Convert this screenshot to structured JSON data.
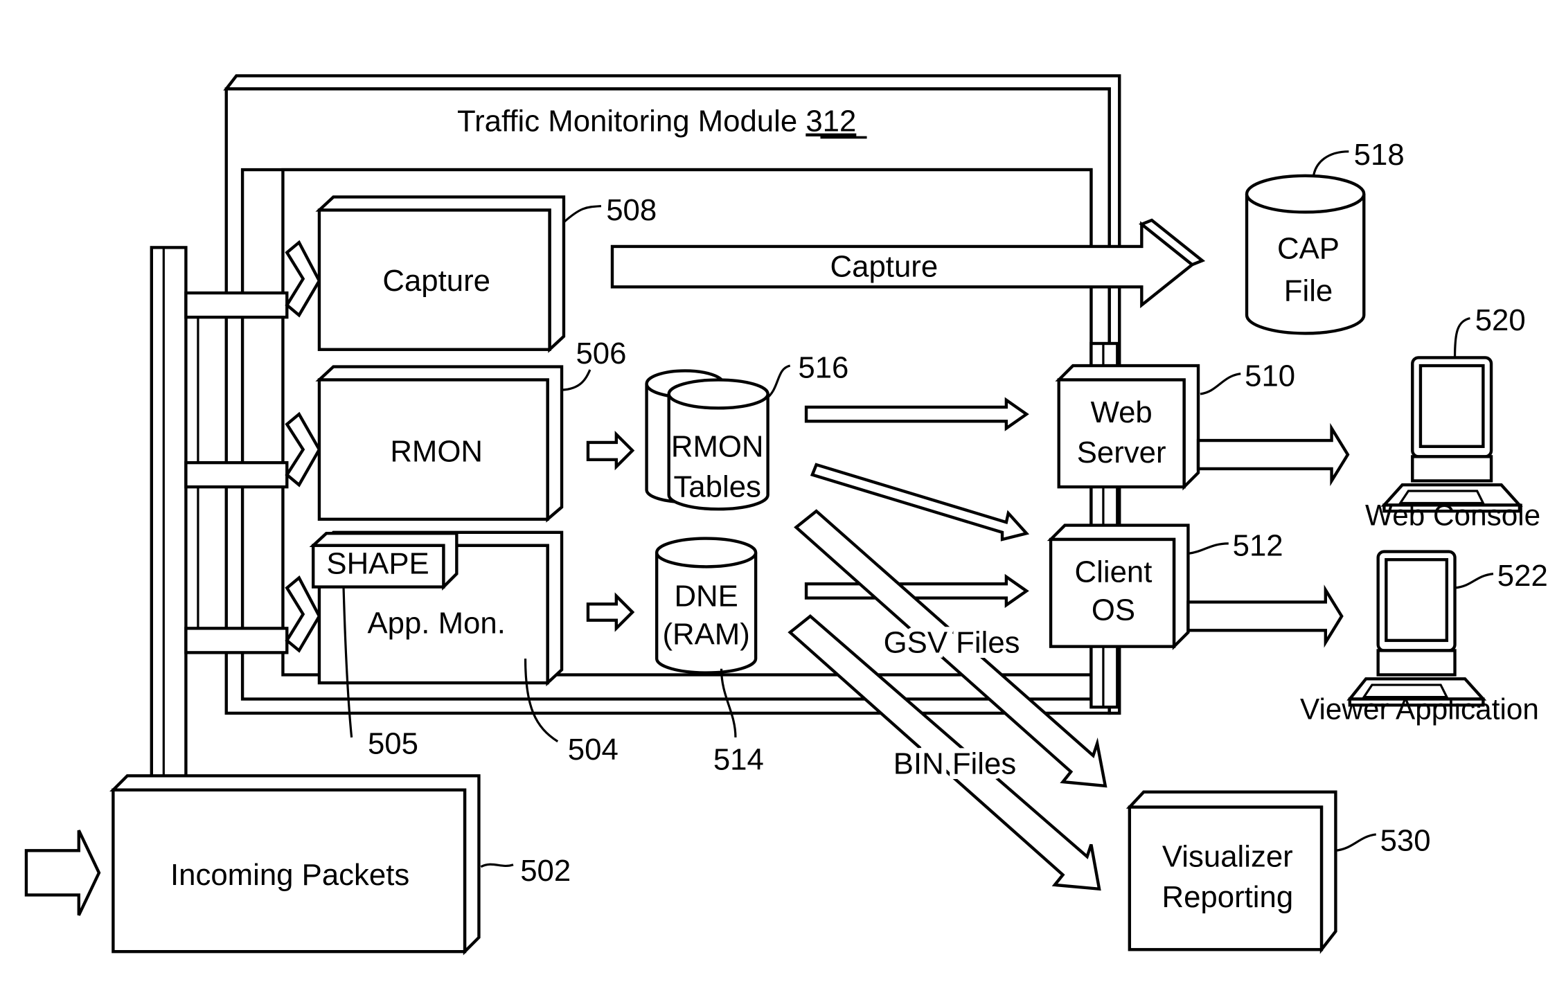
{
  "module": {
    "title_text": "Traffic Monitoring Module ",
    "title_ref": "312"
  },
  "blocks": {
    "capture": {
      "label": "Capture",
      "ref": "508"
    },
    "rmon": {
      "label": "RMON",
      "ref": "506"
    },
    "app_mon": {
      "label": "App. Mon.",
      "ref": "504"
    },
    "shape": {
      "label": "SHAPE",
      "ref": "505"
    },
    "incoming": {
      "label": "Incoming Packets",
      "ref": "502"
    },
    "web_server": {
      "line1": "Web",
      "line2": "Server",
      "ref": "510"
    },
    "client_os": {
      "line1": "Client",
      "line2": "OS",
      "ref": "512"
    },
    "visualizer": {
      "line1": "Visualizer",
      "line2": "Reporting",
      "ref": "530"
    }
  },
  "stores": {
    "rmon_tables": {
      "line1": "RMON",
      "line2": "Tables",
      "ref": "516"
    },
    "dne_ram": {
      "line1": "DNE",
      "line2": "(RAM)",
      "ref": "514"
    },
    "cap_file": {
      "line1": "CAP",
      "line2": "File",
      "ref": "518"
    }
  },
  "terminals": {
    "web_console": {
      "label": "Web Console",
      "ref": "520"
    },
    "viewer_app": {
      "label": "Viewer Application",
      "ref": "522"
    }
  },
  "flows": {
    "capture_arrow": "Capture",
    "gsv_files": "GSV Files",
    "bin_files": "BIN Files"
  }
}
